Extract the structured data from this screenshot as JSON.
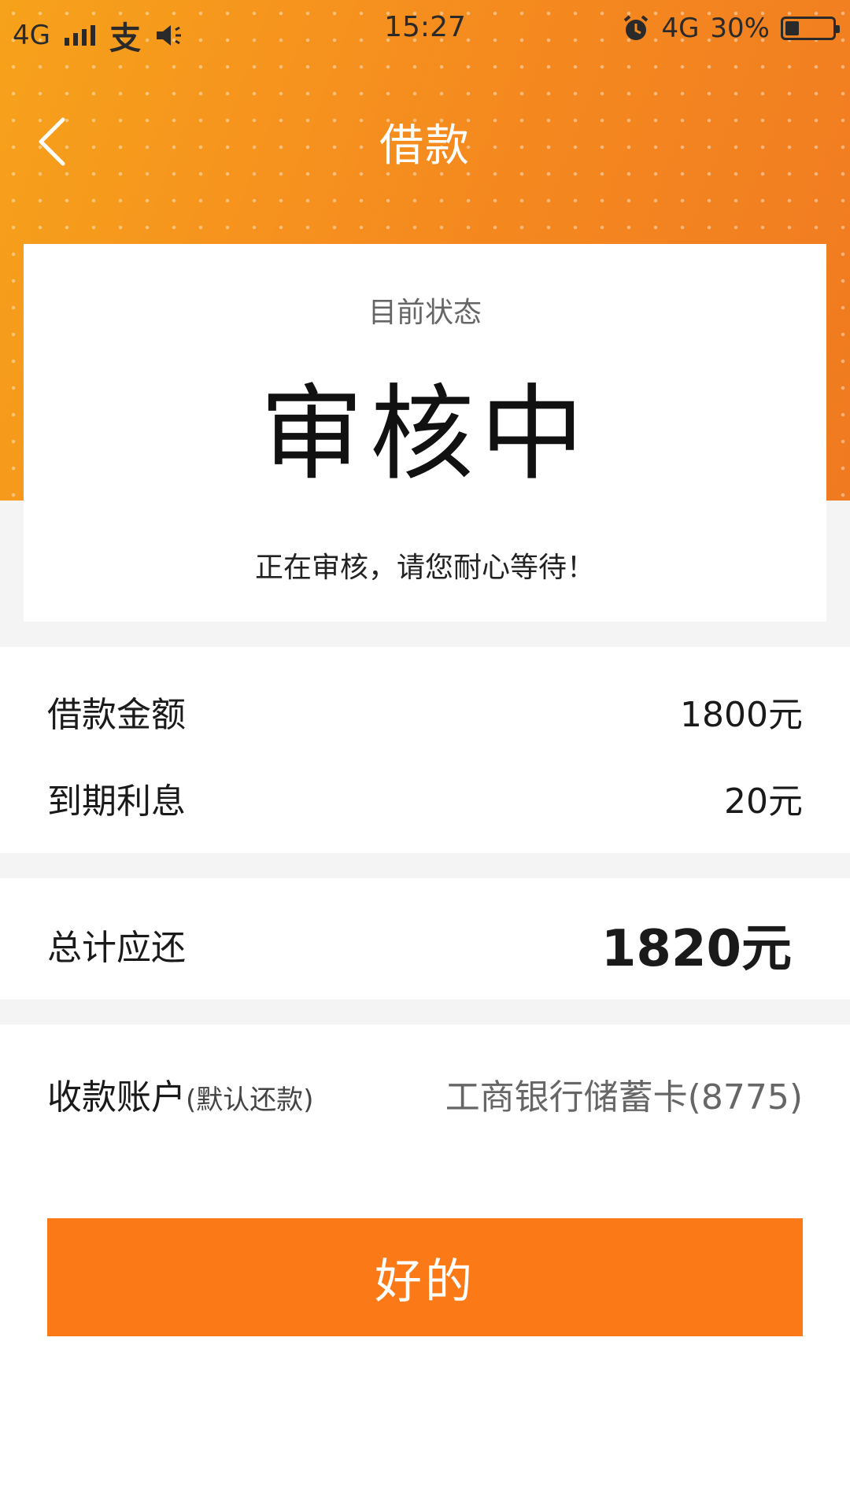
{
  "status_bar": {
    "network_left": "4G",
    "carrier_icon": "alipay-icon",
    "time": "15:27",
    "network_right": "4G",
    "battery_percent": "30%",
    "battery_level": 0.3
  },
  "nav": {
    "title": "借款",
    "back_icon": "chevron-left-icon"
  },
  "status_card": {
    "label": "目前状态",
    "state": "审核中",
    "message": "正在审核，请您耐心等待！"
  },
  "loan": {
    "amount_label": "借款金额",
    "amount_value": "1800元",
    "interest_label": "到期利息",
    "interest_value": "20元"
  },
  "total": {
    "label": "总计应还",
    "value": "1820元"
  },
  "account": {
    "label": "收款账户",
    "note": "(默认还款)",
    "value": "工商银行储蓄卡(8775)"
  },
  "button": {
    "label": "好的"
  },
  "colors": {
    "header_orange": "#f58a1f",
    "button_orange": "#fb7a17"
  }
}
